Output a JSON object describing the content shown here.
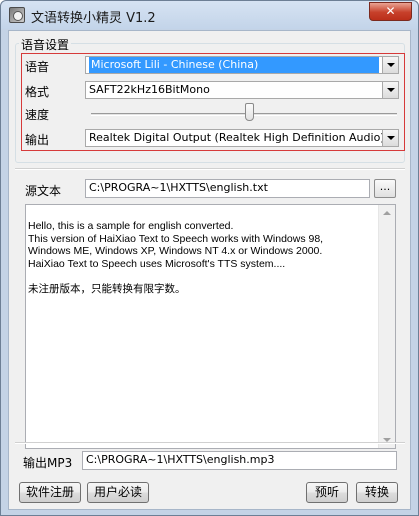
{
  "window": {
    "title": "文语转换小精灵 V1.2",
    "close_label": "✕"
  },
  "voice_settings": {
    "group_title": "语音设置",
    "voice_label": "语音",
    "voice_value": "Microsoft Lili - Chinese (China)",
    "format_label": "格式",
    "format_value": "SAFT22kHz16BitMono",
    "speed_label": "速度",
    "speed_level": 0.52,
    "output_label": "输出",
    "output_value": "Realtek Digital Output (Realtek High Definition Audio)"
  },
  "source": {
    "label": "源文本",
    "path": "C:\\PROGRA~1\\HXTTS\\english.txt",
    "browse_label": "..."
  },
  "text_area": {
    "lines": [
      "Hello, this is a sample for english converted.",
      "This version of HaiXiao Text to Speech works with Windows 98,",
      "Windows ME, Windows XP, Windows NT 4.x or Windows 2000.",
      "HaiXiao Text to Speech uses Microsoft's TTS system....",
      "",
      "未注册版本，只能转换有限字数。"
    ]
  },
  "output_mp3": {
    "label": "输出MP3",
    "path": "C:\\PROGRA~1\\HXTTS\\english.mp3"
  },
  "buttons": {
    "register": "软件注册",
    "must_read": "用户必读",
    "preview": "预听",
    "convert": "转换"
  },
  "icons": {
    "app": "app-icon",
    "close": "close-icon",
    "dropdown": "chevron-down-icon",
    "scroll_up": "scroll-up-arrow-icon",
    "scroll_down": "scroll-down-arrow-icon"
  },
  "colors": {
    "selection": "#3399ff",
    "highlight_border": "#d63a3a",
    "close_button": "#c7402a"
  }
}
